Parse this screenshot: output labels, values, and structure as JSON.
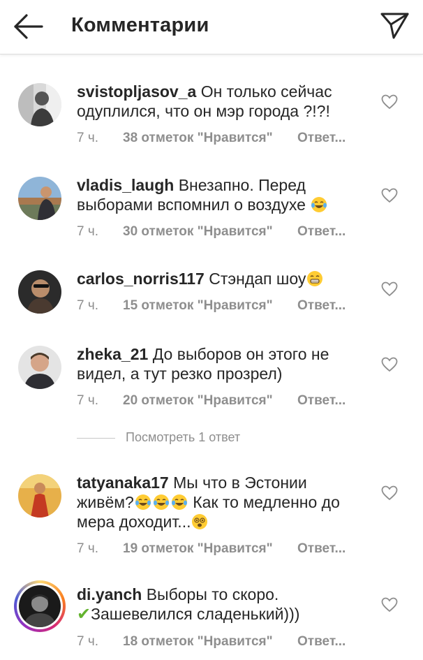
{
  "header": {
    "title": "Комментарии",
    "back_icon": "arrow-left-icon",
    "direct_icon": "paper-plane-icon"
  },
  "colors": {
    "text": "#262626",
    "secondary": "#8e8e8e",
    "divider": "#dbdbdb",
    "check": "#63b32e"
  },
  "comments": [
    {
      "username": "svistopljasov_a",
      "text": "Он только сейчас одуплился, что он мэр города ?!?!",
      "time": "7 ч.",
      "likes": "38 отметок \"Нравится\"",
      "reply": "Ответ..."
    },
    {
      "username": "vladis_laugh",
      "text": "Внезапно. Перед выборами вспомнил о воздухе",
      "emoji_after": "tears-of-joy",
      "time": "7 ч.",
      "likes": "30 отметок \"Нравится\"",
      "reply": "Ответ..."
    },
    {
      "username": "carlos_norris117",
      "text": "Стэндап шоу",
      "emoji_after": "grin",
      "time": "7 ч.",
      "likes": "15 отметок \"Нравится\"",
      "reply": "Ответ..."
    },
    {
      "username": "zheka_21",
      "text": "До выборов он этого не видел, а тут резко прозрел)",
      "time": "7 ч.",
      "likes": "20 отметок \"Нравится\"",
      "reply": "Ответ..."
    },
    {
      "username": "tatyanaka17",
      "text_part1": "Мы что в Эстонии живём?",
      "text_part2": " Как то медленно до мера доходит...",
      "emoji_mid": "tears-of-joy x3",
      "emoji_after": "dizzy-face",
      "time": "7 ч.",
      "likes": "19 отметок \"Нравится\"",
      "reply": "Ответ..."
    },
    {
      "username": "di.yanch",
      "text_part1": "Выборы то скоро.",
      "check": "✔",
      "text_part2": "Зашевелился сладенький)))",
      "time": "7 ч.",
      "likes": "18 отметок \"Нравится\"",
      "reply": "Ответ..."
    }
  ],
  "view_replies": "Посмотреть 1 ответ"
}
